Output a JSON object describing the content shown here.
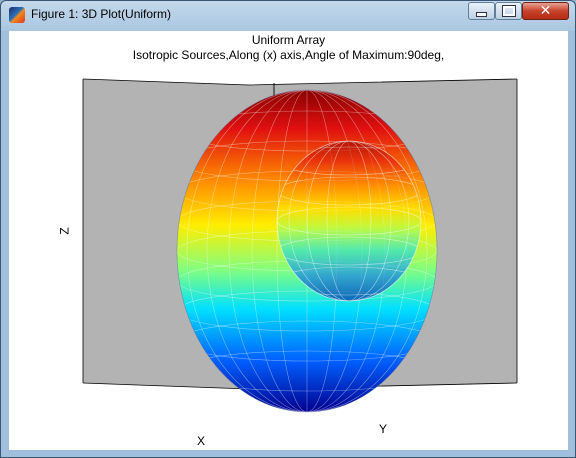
{
  "window": {
    "title": "Figure 1: 3D Plot(Uniform)",
    "controls": [
      "minimize",
      "maximize",
      "close"
    ]
  },
  "figure": {
    "title": "Uniform Array",
    "subtitle": "Isotropic Sources,Along (x) axis,Angle of Maximum:90deg,",
    "xlabel": "X",
    "ylabel": "Y",
    "zlabel": "Z",
    "box_color": "#b3b3b3",
    "colormap": "jet"
  },
  "chart_data": {
    "type": "surface",
    "surface_kind": "3D radiation pattern (wireframe mesh)",
    "title": "Uniform Array",
    "subtitle": "Isotropic Sources,Along (x) axis,Angle of Maximum:90deg,",
    "xlabel": "X",
    "ylabel": "Y",
    "zlabel": "Z",
    "colormap": "jet",
    "grid": false,
    "tick_labels": false
  }
}
